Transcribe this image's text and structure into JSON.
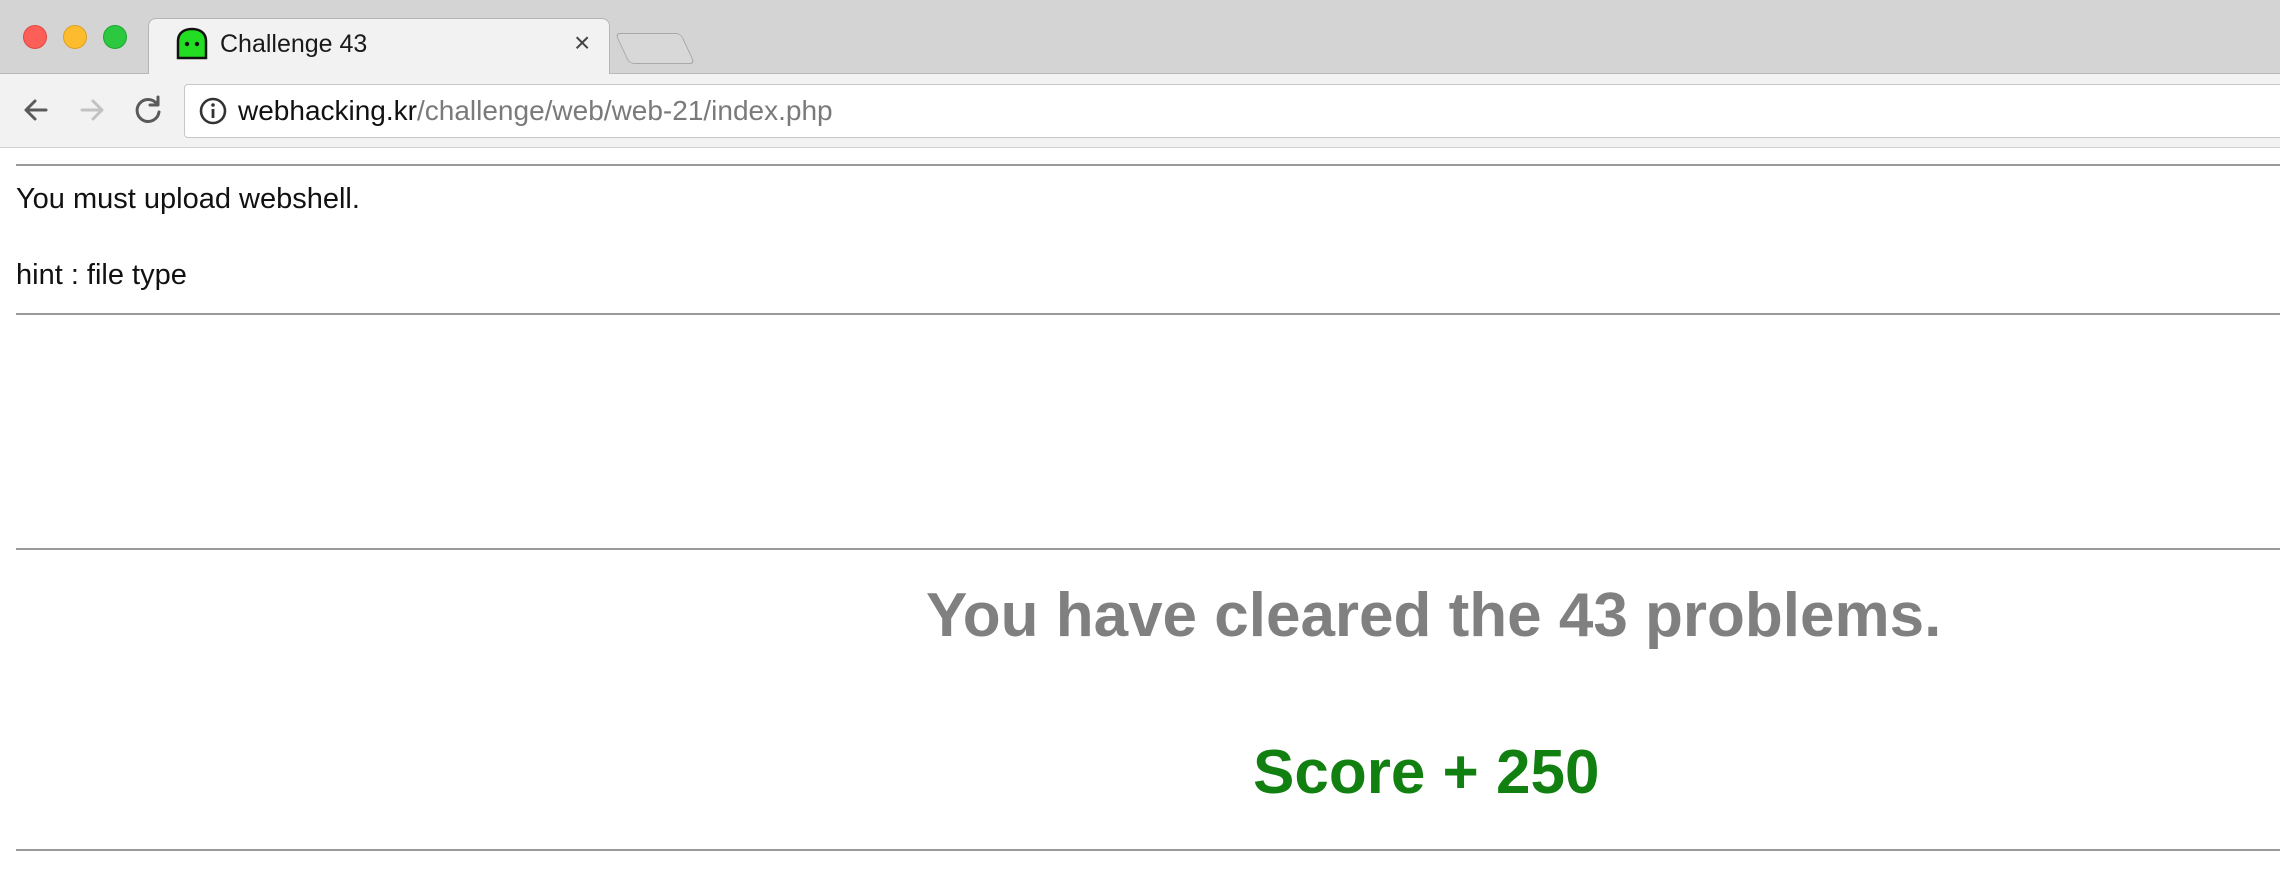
{
  "window": {
    "controls": [
      "close",
      "minimize",
      "maximize"
    ]
  },
  "tab": {
    "title": "Challenge 43",
    "favicon": "green-ghost-icon",
    "close_icon": "×"
  },
  "toolbar": {
    "back_icon": "arrow-left-icon",
    "forward_icon": "arrow-right-icon",
    "reload_icon": "reload-icon",
    "url_host": "webhacking.kr",
    "url_path": "/challenge/web/web-21/index.php"
  },
  "page": {
    "line1": "You must upload webshell.",
    "line2": "hint : file type",
    "cleared_message": "You have cleared the 43 problems.",
    "score_message": "Score + 250"
  },
  "colors": {
    "cleared_text": "#808080",
    "score_text": "#118011",
    "favicon": "#22dd22"
  }
}
